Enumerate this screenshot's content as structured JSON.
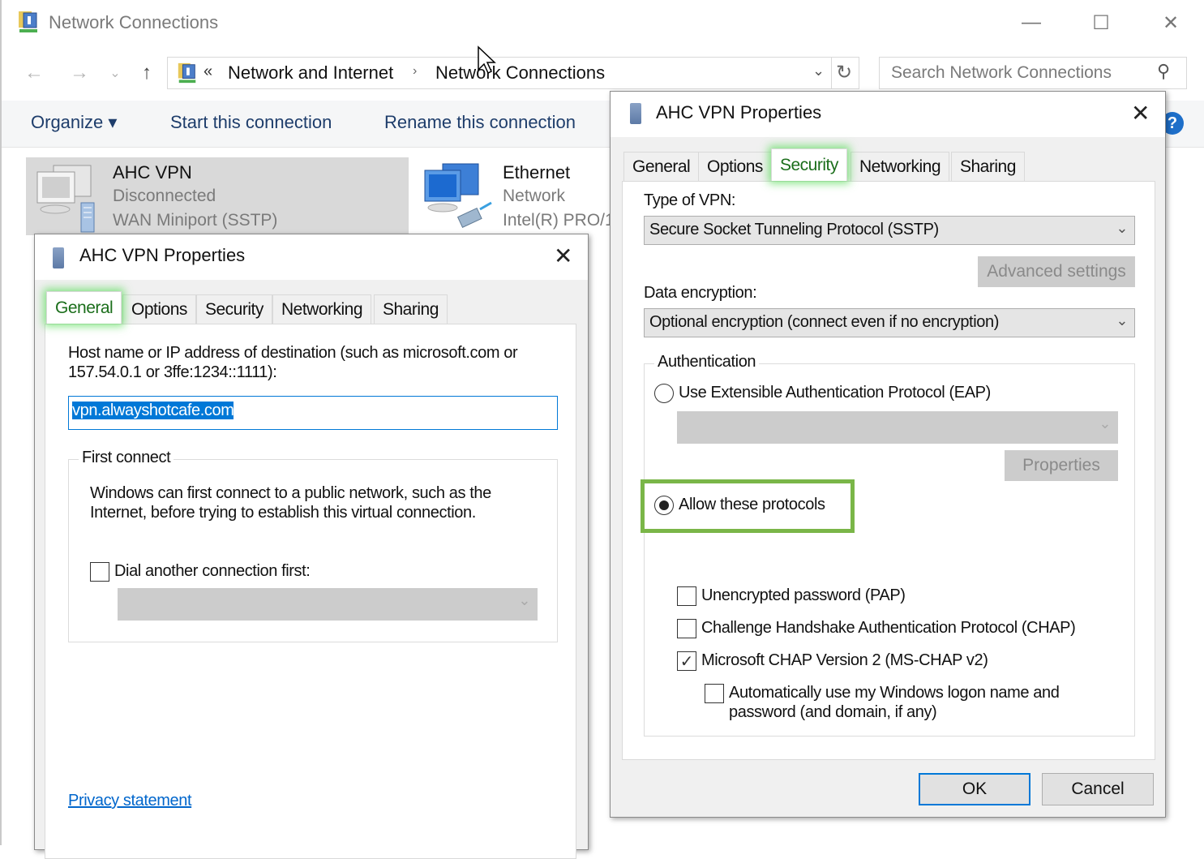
{
  "explorer": {
    "title": "Network Connections",
    "window_controls": {
      "minimize": "—",
      "maximize": "☐",
      "close": "✕"
    },
    "nav": {
      "back": "←",
      "forward": "→",
      "recent": "⌄",
      "up": "↑"
    },
    "address": {
      "overflow": "«",
      "segments": [
        "Network and Internet",
        "Network Connections"
      ],
      "separator": "›",
      "dropdown": "⌄",
      "refresh": "↻"
    },
    "search": {
      "placeholder": "Search Network Connections",
      "icon": "⚲"
    },
    "command_bar": {
      "organize": "Organize ▾",
      "start": "Start this connection",
      "rename": "Rename this connection"
    },
    "help": "?",
    "connections": [
      {
        "name": "AHC VPN",
        "status": "Disconnected",
        "device": "WAN Miniport (SSTP)",
        "selected": true
      },
      {
        "name": "Ethernet",
        "status": "Network",
        "device": "Intel(R) PRO/1",
        "selected": false
      }
    ]
  },
  "general_dialog": {
    "title": "AHC VPN Properties",
    "close": "✕",
    "tabs": [
      "General",
      "Options",
      "Security",
      "Networking",
      "Sharing"
    ],
    "active_tab": "General",
    "host_label_line1": "Host name or IP address of destination (such as microsoft.com or",
    "host_label_line2": "157.54.0.1 or 3ffe:1234::1111):",
    "host_value": "vpn.alwayshotcafe.com",
    "first_connect": {
      "legend": "First connect",
      "desc_line1": "Windows can first connect to a public network, such as the",
      "desc_line2": "Internet, before trying to establish this virtual connection.",
      "dial_label": "Dial another connection first:",
      "dial_checked": false,
      "dial_select_value": "",
      "chevron": "⌄"
    },
    "privacy_link": "Privacy statement"
  },
  "security_dialog": {
    "title": "AHC VPN Properties",
    "close": "✕",
    "tabs": [
      "General",
      "Options",
      "Security",
      "Networking",
      "Sharing"
    ],
    "active_tab": "Security",
    "vpn_type_label": "Type of VPN:",
    "vpn_type_value": "Secure Socket Tunneling Protocol (SSTP)",
    "advanced_settings": "Advanced settings",
    "encryption_label": "Data encryption:",
    "encryption_value": "Optional encryption (connect even if no encryption)",
    "chevron": "⌄",
    "authentication": {
      "legend": "Authentication",
      "eap_label": "Use Extensible Authentication Protocol (EAP)",
      "eap_selected": false,
      "eap_select_value": "",
      "properties": "Properties",
      "allow_label": "Allow these protocols",
      "allow_selected": true,
      "protocols": [
        {
          "label": "Unencrypted password (PAP)",
          "checked": false
        },
        {
          "label": "Challenge Handshake Authentication Protocol (CHAP)",
          "checked": false
        },
        {
          "label": "Microsoft CHAP Version 2 (MS-CHAP v2)",
          "checked": true
        }
      ],
      "auto_logon_line1": "Automatically use my Windows logon name and",
      "auto_logon_line2": "password (and domain, if any)",
      "auto_logon_checked": false
    },
    "ok": "OK",
    "cancel": "Cancel",
    "check_mark": "✓",
    "highlight_color": "#7ab648"
  }
}
